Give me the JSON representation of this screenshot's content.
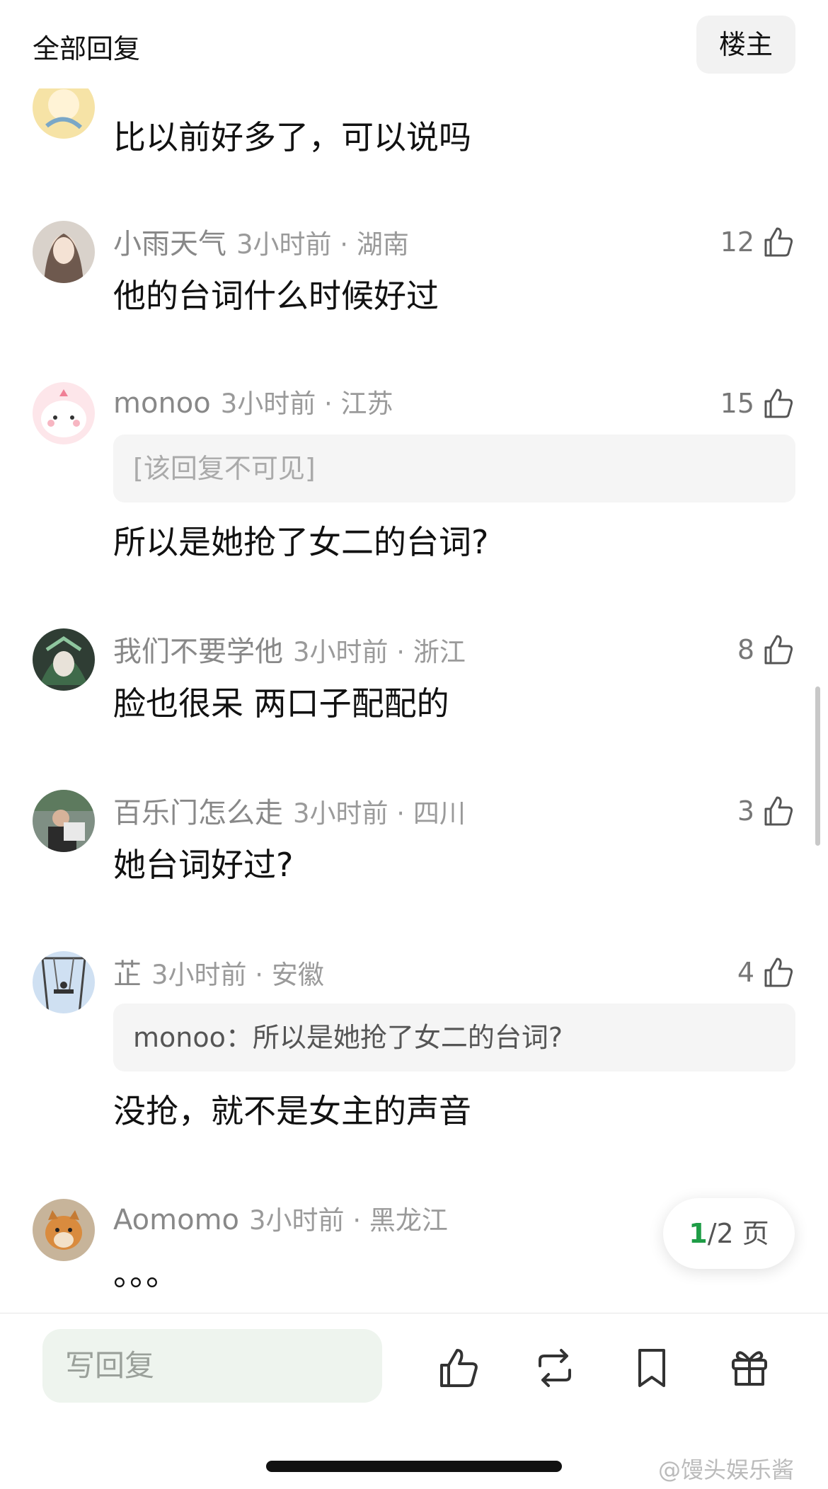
{
  "header": {
    "title": "全部回复",
    "owner_button": "楼主"
  },
  "comments": [
    {
      "name": "",
      "time": "",
      "likes": "",
      "text": "比以前好多了，可以说吗",
      "quote": ""
    },
    {
      "name": "小雨天气",
      "time": "3小时前 · 湖南",
      "likes": "12",
      "text": "他的台词什么时候好过",
      "quote": ""
    },
    {
      "name": "monoo",
      "time": "3小时前 · 江苏",
      "likes": "15",
      "text": "所以是她抢了女二的台词?",
      "quote": "[该回复不可见]"
    },
    {
      "name": "我们不要学他",
      "time": "3小时前 · 浙江",
      "likes": "8",
      "text": "脸也很呆 两口子配配的",
      "quote": ""
    },
    {
      "name": "百乐门怎么走",
      "time": "3小时前 · 四川",
      "likes": "3",
      "text": "她台词好过?",
      "quote": ""
    },
    {
      "name": "芷",
      "time": "3小时前 · 安徽",
      "likes": "4",
      "text": "没抢，就不是女主的声音",
      "quote": "monoo：所以是她抢了女二的台词?"
    },
    {
      "name": "Aomomo",
      "time": "3小时前 · 黑龙江",
      "likes": "",
      "text": "。。。",
      "quote": ""
    }
  ],
  "pagination": {
    "current": "1",
    "total": "/2 页"
  },
  "bottom": {
    "reply_placeholder": "写回复",
    "watermark": "@馒头娱乐酱"
  },
  "icons": {
    "like": "thumbs-up-icon",
    "repost": "repost-icon",
    "bookmark": "bookmark-icon",
    "gift": "gift-icon"
  },
  "colors": {
    "accent_green": "#1f9d47",
    "input_bg": "#eef4ee",
    "meta_gray": "#888888"
  }
}
